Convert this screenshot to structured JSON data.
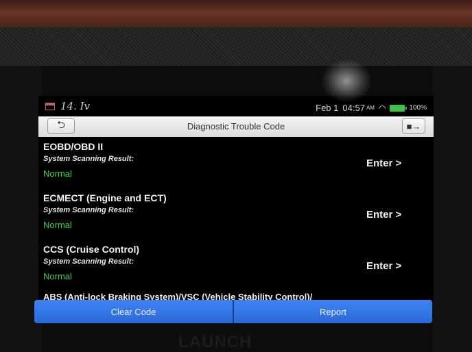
{
  "status_bar": {
    "handwriting": "14. Iv",
    "date": "Feb 1",
    "time": "04:57",
    "ampm": "AM",
    "battery": "100%"
  },
  "title_bar": {
    "title": "Diagnostic Trouble Code",
    "back_icon": "back-arrow-icon",
    "exit_icon": "exit-door-icon"
  },
  "systems": [
    {
      "name": "EOBD/OBD II",
      "label": "System Scanning Result:",
      "status": "Normal",
      "action": "Enter >"
    },
    {
      "name": "ECMECT (Engine and ECT)",
      "label": "System Scanning Result:",
      "status": "Normal",
      "action": "Enter >"
    },
    {
      "name": "CCS (Cruise Control)",
      "label": "System Scanning Result:",
      "status": "Normal",
      "action": "Enter >"
    }
  ],
  "partial_item": "ABS (Anti-lock Braking System)/VSC (Vehicle Stability Control)/",
  "bottom_bar": {
    "clear_code": "Clear Code",
    "report": "Report"
  },
  "brand": "LAUNCH",
  "colors": {
    "status_normal": "#3ed24a",
    "button_blue": "#3e83f2",
    "battery": "#3ec24a"
  }
}
